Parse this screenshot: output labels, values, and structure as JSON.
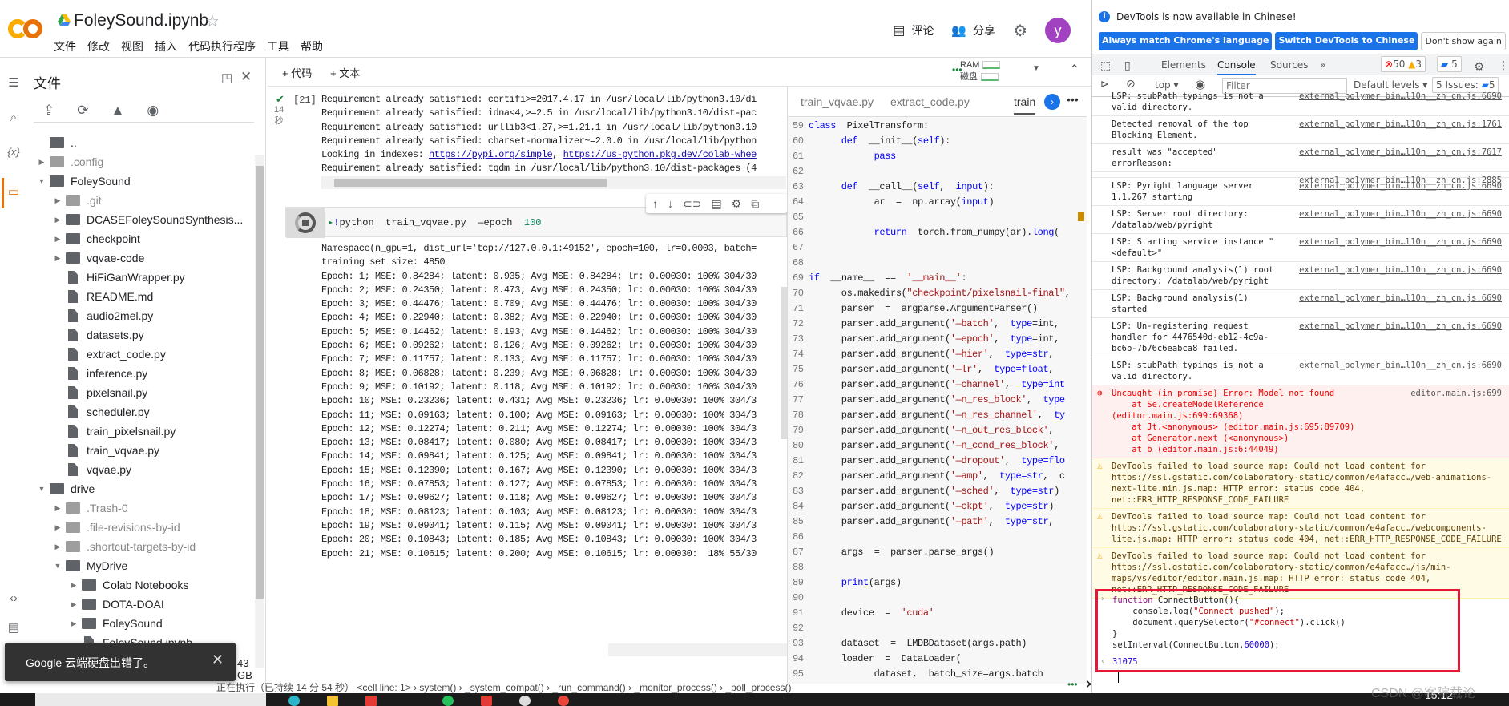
{
  "header": {
    "title": "FoleySound.ipynb",
    "logo_text": "CO",
    "menu": [
      "文件",
      "修改",
      "视图",
      "插入",
      "代码执行程序",
      "工具",
      "帮助"
    ],
    "comment_label": "评论",
    "share_label": "分享",
    "avatar_letter": "y",
    "avatar_color": "#a142c0"
  },
  "toolbar": {
    "add_code": "+ 代码",
    "add_text": "+ 文本",
    "ram_label": "RAM",
    "disk_label": "磁盘"
  },
  "files_panel": {
    "title": "文件",
    "disk_text": "43 GB",
    "tree": [
      {
        "label": "..",
        "kind": "up",
        "depth": 0
      },
      {
        "label": ".config",
        "kind": "folder",
        "depth": 0,
        "toggle": "collapsed",
        "dim": true
      },
      {
        "label": "FoleySound",
        "kind": "folder",
        "depth": 0,
        "toggle": "expanded"
      },
      {
        "label": ".git",
        "kind": "folder",
        "depth": 1,
        "toggle": "collapsed",
        "dim": true
      },
      {
        "label": "DCASEFoleySoundSynthesis...",
        "kind": "folder",
        "depth": 1,
        "toggle": "collapsed"
      },
      {
        "label": "checkpoint",
        "kind": "folder",
        "depth": 1,
        "toggle": "collapsed"
      },
      {
        "label": "vqvae-code",
        "kind": "folder",
        "depth": 1,
        "toggle": "collapsed"
      },
      {
        "label": "HiFiGanWrapper.py",
        "kind": "file",
        "depth": 1
      },
      {
        "label": "README.md",
        "kind": "file",
        "depth": 1
      },
      {
        "label": "audio2mel.py",
        "kind": "file",
        "depth": 1
      },
      {
        "label": "datasets.py",
        "kind": "file",
        "depth": 1
      },
      {
        "label": "extract_code.py",
        "kind": "file",
        "depth": 1
      },
      {
        "label": "inference.py",
        "kind": "file",
        "depth": 1
      },
      {
        "label": "pixelsnail.py",
        "kind": "file",
        "depth": 1
      },
      {
        "label": "scheduler.py",
        "kind": "file",
        "depth": 1
      },
      {
        "label": "train_pixelsnail.py",
        "kind": "file",
        "depth": 1
      },
      {
        "label": "train_vqvae.py",
        "kind": "file",
        "depth": 1
      },
      {
        "label": "vqvae.py",
        "kind": "file",
        "depth": 1
      },
      {
        "label": "drive",
        "kind": "folder",
        "depth": 0,
        "toggle": "expanded"
      },
      {
        "label": ".Trash-0",
        "kind": "folder",
        "depth": 1,
        "toggle": "collapsed",
        "dim": true
      },
      {
        "label": ".file-revisions-by-id",
        "kind": "folder",
        "depth": 1,
        "toggle": "collapsed",
        "dim": true
      },
      {
        "label": ".shortcut-targets-by-id",
        "kind": "folder",
        "depth": 1,
        "toggle": "collapsed",
        "dim": true
      },
      {
        "label": "MyDrive",
        "kind": "folder",
        "depth": 1,
        "toggle": "expanded"
      },
      {
        "label": "Colab Notebooks",
        "kind": "folder",
        "depth": 2,
        "toggle": "collapsed"
      },
      {
        "label": "DOTA-DOAI",
        "kind": "folder",
        "depth": 2,
        "toggle": "collapsed"
      },
      {
        "label": "FoleySound",
        "kind": "folder",
        "depth": 2,
        "toggle": "collapsed"
      },
      {
        "label": "FoleySound.ipynb",
        "kind": "file",
        "depth": 2
      }
    ]
  },
  "toast": {
    "text": "Google 云端硬盘出错了。"
  },
  "cell1": {
    "exec_count": "[21]",
    "duration": "14\n秒",
    "output": [
      "Requirement already satisfied: certifi>=2017.4.17 in /usr/local/lib/python3.10/di",
      "Requirement already satisfied: idna<4,>=2.5 in /usr/local/lib/python3.10/dist-pac",
      "Requirement already satisfied: urllib3<1.27,>=1.21.1 in /usr/local/lib/python3.10",
      "Requirement already satisfied: charset-normalizer~=2.0.0 in /usr/local/lib/python",
      "Requirement already satisfied: tqdm in /usr/local/lib/python3.10/dist-packages (4"
    ],
    "index_line": {
      "prefix": "Looking in indexes: ",
      "link1": "https://pypi.org/simple",
      "sep": ", ",
      "link2": "https://us-python.pkg.dev/colab-whee"
    }
  },
  "cell2": {
    "code": {
      "bang": "!",
      "cmd": "python  train_vqvae.py  —epoch  ",
      "num": "100"
    },
    "output": [
      "Namespace(n_gpu=1, dist_url='tcp://127.0.0.1:49152', epoch=100, lr=0.0003, batch=",
      "training set size: 4850",
      "Epoch: 1; MSE: 0.84284; latent: 0.935; Avg MSE: 0.84284; lr: 0.00030: 100% 304/30",
      "Epoch: 2; MSE: 0.24350; latent: 0.473; Avg MSE: 0.24350; lr: 0.00030: 100% 304/30",
      "Epoch: 3; MSE: 0.44476; latent: 0.709; Avg MSE: 0.44476; lr: 0.00030: 100% 304/30",
      "Epoch: 4; MSE: 0.22940; latent: 0.382; Avg MSE: 0.22940; lr: 0.00030: 100% 304/30",
      "Epoch: 5; MSE: 0.14462; latent: 0.193; Avg MSE: 0.14462; lr: 0.00030: 100% 304/30",
      "Epoch: 6; MSE: 0.09262; latent: 0.126; Avg MSE: 0.09262; lr: 0.00030: 100% 304/30",
      "Epoch: 7; MSE: 0.11757; latent: 0.133; Avg MSE: 0.11757; lr: 0.00030: 100% 304/30",
      "Epoch: 8; MSE: 0.06828; latent: 0.239; Avg MSE: 0.06828; lr: 0.00030: 100% 304/30",
      "Epoch: 9; MSE: 0.10192; latent: 0.118; Avg MSE: 0.10192; lr: 0.00030: 100% 304/30",
      "Epoch: 10; MSE: 0.23236; latent: 0.431; Avg MSE: 0.23236; lr: 0.00030: 100% 304/3",
      "Epoch: 11; MSE: 0.09163; latent: 0.100; Avg MSE: 0.09163; lr: 0.00030: 100% 304/3",
      "Epoch: 12; MSE: 0.12274; latent: 0.211; Avg MSE: 0.12274; lr: 0.00030: 100% 304/3",
      "Epoch: 13; MSE: 0.08417; latent: 0.080; Avg MSE: 0.08417; lr: 0.00030: 100% 304/3",
      "Epoch: 14; MSE: 0.09841; latent: 0.125; Avg MSE: 0.09841; lr: 0.00030: 100% 304/3",
      "Epoch: 15; MSE: 0.12390; latent: 0.167; Avg MSE: 0.12390; lr: 0.00030: 100% 304/3",
      "Epoch: 16; MSE: 0.07853; latent: 0.127; Avg MSE: 0.07853; lr: 0.00030: 100% 304/3",
      "Epoch: 17; MSE: 0.09627; latent: 0.118; Avg MSE: 0.09627; lr: 0.00030: 100% 304/3",
      "Epoch: 18; MSE: 0.08123; latent: 0.103; Avg MSE: 0.08123; lr: 0.00030: 100% 304/3",
      "Epoch: 19; MSE: 0.09041; latent: 0.115; Avg MSE: 0.09041; lr: 0.00030: 100% 304/3",
      "Epoch: 20; MSE: 0.10843; latent: 0.185; Avg MSE: 0.10843; lr: 0.00030: 100% 304/3",
      "Epoch: 21; MSE: 0.10615; latent: 0.200; Avg MSE: 0.10615; lr: 0.00030:  18% 55/30"
    ]
  },
  "editor": {
    "tabs": [
      "train_vqvae.py",
      "extract_code.py",
      "train"
    ],
    "active_tab": 2,
    "lines": [
      {
        "n": 59,
        "t": [
          [
            "class",
            "k"
          ],
          [
            "  PixelTransform:",
            "p"
          ]
        ]
      },
      {
        "n": 60,
        "t": [
          [
            "      def",
            "k"
          ],
          [
            "  __init__(",
            "p"
          ],
          [
            "self",
            "k"
          ],
          [
            "):",
            "p"
          ]
        ]
      },
      {
        "n": 61,
        "t": [
          [
            "            pass",
            "k"
          ]
        ]
      },
      {
        "n": 62,
        "t": []
      },
      {
        "n": 63,
        "t": [
          [
            "      def",
            "k"
          ],
          [
            "  __call__(",
            "p"
          ],
          [
            "self",
            "k"
          ],
          [
            ",  ",
            "p"
          ],
          [
            "input",
            "k"
          ],
          [
            "):",
            "p"
          ]
        ]
      },
      {
        "n": 64,
        "t": [
          [
            "            ar  =  np.array(",
            "p"
          ],
          [
            "input",
            "k"
          ],
          [
            ")",
            "p"
          ]
        ]
      },
      {
        "n": 65,
        "t": []
      },
      {
        "n": 66,
        "t": [
          [
            "            return",
            "k"
          ],
          [
            "  torch.from_numpy(ar).",
            "p"
          ],
          [
            "long",
            "k"
          ],
          [
            "(",
            "p"
          ]
        ]
      },
      {
        "n": 67,
        "t": []
      },
      {
        "n": 68,
        "t": []
      },
      {
        "n": 69,
        "t": [
          [
            "if",
            "k"
          ],
          [
            "  __name__  ==  ",
            "p"
          ],
          [
            "'__main__'",
            "s"
          ],
          [
            ":",
            "p"
          ]
        ]
      },
      {
        "n": 70,
        "t": [
          [
            "      os.makedirs(",
            "p"
          ],
          [
            "\"checkpoint/pixelsnail-final\"",
            "s"
          ],
          [
            ",",
            "p"
          ]
        ]
      },
      {
        "n": 71,
        "t": [
          [
            "      parser  =  argparse.ArgumentParser()",
            "p"
          ]
        ]
      },
      {
        "n": 72,
        "t": [
          [
            "      parser.add_argument(",
            "p"
          ],
          [
            "'—batch'",
            "s"
          ],
          [
            ",  ",
            "p"
          ],
          [
            "type",
            "k"
          ],
          [
            "=int,",
            "p"
          ]
        ]
      },
      {
        "n": 73,
        "t": [
          [
            "      parser.add_argument(",
            "p"
          ],
          [
            "'—epoch'",
            "s"
          ],
          [
            ",  ",
            "p"
          ],
          [
            "type",
            "k"
          ],
          [
            "=int,",
            "p"
          ]
        ]
      },
      {
        "n": 74,
        "t": [
          [
            "      parser.add_argument(",
            "p"
          ],
          [
            "'—hier'",
            "s"
          ],
          [
            ",  ",
            "p"
          ],
          [
            "type=str",
            "k"
          ],
          [
            ",",
            "p"
          ]
        ]
      },
      {
        "n": 75,
        "t": [
          [
            "      parser.add_argument(",
            "p"
          ],
          [
            "'—lr'",
            "s"
          ],
          [
            ",  ",
            "p"
          ],
          [
            "type=float",
            "k"
          ],
          [
            ",",
            "p"
          ]
        ]
      },
      {
        "n": 76,
        "t": [
          [
            "      parser.add_argument(",
            "p"
          ],
          [
            "'—channel'",
            "s"
          ],
          [
            ",  ",
            "p"
          ],
          [
            "type=int",
            "k"
          ]
        ]
      },
      {
        "n": 77,
        "t": [
          [
            "      parser.add_argument(",
            "p"
          ],
          [
            "'—n_res_block'",
            "s"
          ],
          [
            ",  ",
            "p"
          ],
          [
            "type",
            "k"
          ]
        ]
      },
      {
        "n": 78,
        "t": [
          [
            "      parser.add_argument(",
            "p"
          ],
          [
            "'—n_res_channel'",
            "s"
          ],
          [
            ",  ",
            "p"
          ],
          [
            "ty",
            "k"
          ]
        ]
      },
      {
        "n": 79,
        "t": [
          [
            "      parser.add_argument(",
            "p"
          ],
          [
            "'—n_out_res_block'",
            "s"
          ],
          [
            ",",
            "p"
          ]
        ]
      },
      {
        "n": 80,
        "t": [
          [
            "      parser.add_argument(",
            "p"
          ],
          [
            "'—n_cond_res_block'",
            "s"
          ],
          [
            ",",
            "p"
          ]
        ]
      },
      {
        "n": 81,
        "t": [
          [
            "      parser.add_argument(",
            "p"
          ],
          [
            "'—dropout'",
            "s"
          ],
          [
            ",  ",
            "p"
          ],
          [
            "type=flo",
            "k"
          ]
        ]
      },
      {
        "n": 82,
        "t": [
          [
            "      parser.add_argument(",
            "p"
          ],
          [
            "'—amp'",
            "s"
          ],
          [
            ",  ",
            "p"
          ],
          [
            "type=str",
            "k"
          ],
          [
            ",  c",
            "p"
          ]
        ]
      },
      {
        "n": 83,
        "t": [
          [
            "      parser.add_argument(",
            "p"
          ],
          [
            "'—sched'",
            "s"
          ],
          [
            ",  ",
            "p"
          ],
          [
            "type=str",
            "k"
          ],
          [
            ")",
            "p"
          ]
        ]
      },
      {
        "n": 84,
        "t": [
          [
            "      parser.add_argument(",
            "p"
          ],
          [
            "'—ckpt'",
            "s"
          ],
          [
            ",  ",
            "p"
          ],
          [
            "type=str",
            "k"
          ],
          [
            ")",
            "p"
          ]
        ]
      },
      {
        "n": 85,
        "t": [
          [
            "      parser.add_argument(",
            "p"
          ],
          [
            "'—path'",
            "s"
          ],
          [
            ",  ",
            "p"
          ],
          [
            "type=str",
            "k"
          ],
          [
            ",",
            "p"
          ]
        ]
      },
      {
        "n": 86,
        "t": []
      },
      {
        "n": 87,
        "t": [
          [
            "      args  =  parser.parse_args()",
            "p"
          ]
        ]
      },
      {
        "n": 88,
        "t": []
      },
      {
        "n": 89,
        "t": [
          [
            "      print",
            "k"
          ],
          [
            "(args)",
            "p"
          ]
        ]
      },
      {
        "n": 90,
        "t": []
      },
      {
        "n": 91,
        "t": [
          [
            "      device  =  ",
            "p"
          ],
          [
            "'cuda'",
            "s"
          ]
        ]
      },
      {
        "n": 92,
        "t": []
      },
      {
        "n": 93,
        "t": [
          [
            "      dataset  =  LMDBDataset(args.path)",
            "p"
          ]
        ]
      },
      {
        "n": 94,
        "t": [
          [
            "      loader  =  DataLoader(",
            "p"
          ]
        ]
      },
      {
        "n": 95,
        "t": [
          [
            "            dataset,  batch_size=args.batch",
            "p"
          ]
        ]
      }
    ]
  },
  "status_bar": {
    "text": "正在执行（已持续 14 分 54 秒）   <cell line: 1> › system() › _system_compat() › _run_command() › _monitor_process() › _poll_process()"
  },
  "devtools": {
    "info_text": "DevTools is now available in Chinese!",
    "btn_match": "Always match Chrome's language",
    "btn_switch": "Switch DevTools to Chinese",
    "btn_dismiss": "Don't show again",
    "tabs": [
      "Elements",
      "Console",
      "Sources",
      "»"
    ],
    "active_tab": 1,
    "error_count": "50",
    "warning_count": "3",
    "message_count": "5",
    "context": "top",
    "filter_placeholder": "Filter",
    "levels": "Default levels",
    "issues_label": "5 Issues:",
    "issues_count": "5",
    "messages": [
      {
        "type": "log",
        "text": "LSP: stubPath typings is not a\nvalid directory.",
        "src": "external_polymer_bin…l10n__zh_cn.js:6690"
      },
      {
        "type": "log",
        "text": "Detected removal of the top\nBlocking Element.",
        "src": "external_polymer_bin…l10n__zh_cn.js:1761"
      },
      {
        "type": "log",
        "text": "result was \"accepted\"\nerrorReason:",
        "src": "external_polymer_bin…l10n__zh_cn.js:7617"
      },
      {
        "type": "log",
        "text": "",
        "src": "external_polymer_bin…l10n__zh_cn.js:2885"
      },
      {
        "type": "log",
        "text": "LSP: Pyright language server\n1.1.267 starting",
        "src": "external_polymer_bin…l10n__zh_cn.js:6690"
      },
      {
        "type": "log",
        "text": "LSP: Server root directory:\n/datalab/web/pyright",
        "src": "external_polymer_bin…l10n__zh_cn.js:6690"
      },
      {
        "type": "log",
        "text": "LSP: Starting service instance \"\n<default>\"",
        "src": "external_polymer_bin…l10n__zh_cn.js:6690"
      },
      {
        "type": "log",
        "text": "LSP: Background analysis(1) root\ndirectory: /datalab/web/pyright",
        "src": "external_polymer_bin…l10n__zh_cn.js:6690"
      },
      {
        "type": "log",
        "text": "LSP: Background analysis(1)\nstarted",
        "src": "external_polymer_bin…l10n__zh_cn.js:6690"
      },
      {
        "type": "log",
        "text": "LSP: Un-registering request\nhandler for 4476540d-eb12-4c9a-bc6b-7b76c6eabca8 failed.",
        "src": "external_polymer_bin…l10n__zh_cn.js:6690"
      },
      {
        "type": "log",
        "text": "LSP: stubPath typings is not a\nvalid directory.",
        "src": "external_polymer_bin…l10n__zh_cn.js:6690"
      },
      {
        "type": "err",
        "text": "Uncaught (in promise) Error: Model not found\n    at Se.createModelReference (editor.main.js:699:69368)\n    at Jt.<anonymous> (editor.main.js:695:89709)\n    at Generator.next (<anonymous>)\n    at b (editor.main.js:6:44049)",
        "src": "editor.main.js:699"
      },
      {
        "type": "warn",
        "text": "DevTools failed to load source map: Could not load content for https://ssl.gstatic.com/colaboratory-static/common/e4afacc…/web-animations-next-lite.min.js.map: HTTP error: status code 404, net::ERR_HTTP_RESPONSE_CODE_FAILURE",
        "src": ""
      },
      {
        "type": "warn",
        "text": "DevTools failed to load source map: Could not load content for https://ssl.gstatic.com/colaboratory-static/common/e4afacc…/webcomponents-lite.js.map: HTTP error: status code 404, net::ERR_HTTP_RESPONSE_CODE_FAILURE",
        "src": ""
      },
      {
        "type": "warn",
        "text": "DevTools failed to load source map: Could not load content for https://ssl.gstatic.com/colaboratory-static/common/e4afacc…/js/min-maps/vs/editor/editor.main.js.map: HTTP error: status code 404, net::ERR_HTTP_RESPONSE_CODE_FAILURE",
        "src": ""
      }
    ],
    "command": {
      "l1_kw": "function",
      "l1_name": " ConnectButton(){",
      "l2a": "    console.log(",
      "l2s": "\"Connect pushed\"",
      "l2b": ");",
      "l3a": "    document.querySelector(",
      "l3s": "\"#connect\"",
      "l3b": ").click()",
      "l4": "}",
      "l5a": "setInterval(ConnectButton,",
      "l5n": "60000",
      "l5b": ");",
      "result": "31075",
      "highlight_color": "#e8173a"
    }
  },
  "taskbar": {
    "clock": "15:12"
  },
  "watermark": "CSDN @客院载论"
}
